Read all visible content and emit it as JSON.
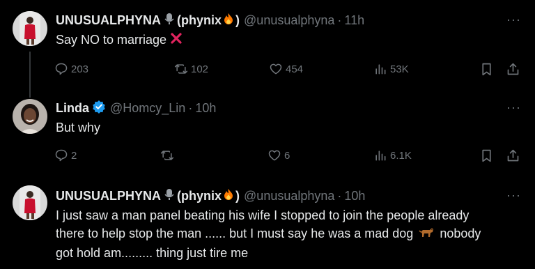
{
  "tweets": [
    {
      "name": "UNUSUALPHYNA",
      "name_suffix": "(phynix",
      "name_close": ")",
      "handle": "@unusualphyna",
      "sep": "·",
      "time": "11h",
      "text": "Say NO to marriage",
      "more": "···",
      "stats": {
        "replies": "203",
        "reposts": "102",
        "likes": "454",
        "views": "53K"
      }
    },
    {
      "name": "Linda",
      "handle": "@Homcy_Lin",
      "sep": "·",
      "time": "10h",
      "text": "But why",
      "more": "···",
      "stats": {
        "replies": "2",
        "reposts": "",
        "likes": "6",
        "views": "6.1K"
      }
    },
    {
      "name": "UNUSUALPHYNA",
      "name_suffix": "(phynix",
      "name_close": ")",
      "handle": "@unusualphyna",
      "sep": "·",
      "time": "10h",
      "text_line1": "I just saw a man panel beating his wife I stopped to join the people already",
      "text_line2_a": "there to help stop the man ...... but I must say he was a mad dog",
      "text_line2_b": "nobody",
      "text_line3": "got hold am......... thing just tire me",
      "more": "···"
    }
  ],
  "colors": {
    "bg": "#000000",
    "text": "#e7e9ea",
    "muted": "#71767b",
    "verified": "#1d9bf0",
    "x_red": "#e0245e",
    "flame": "#ff7a00"
  }
}
